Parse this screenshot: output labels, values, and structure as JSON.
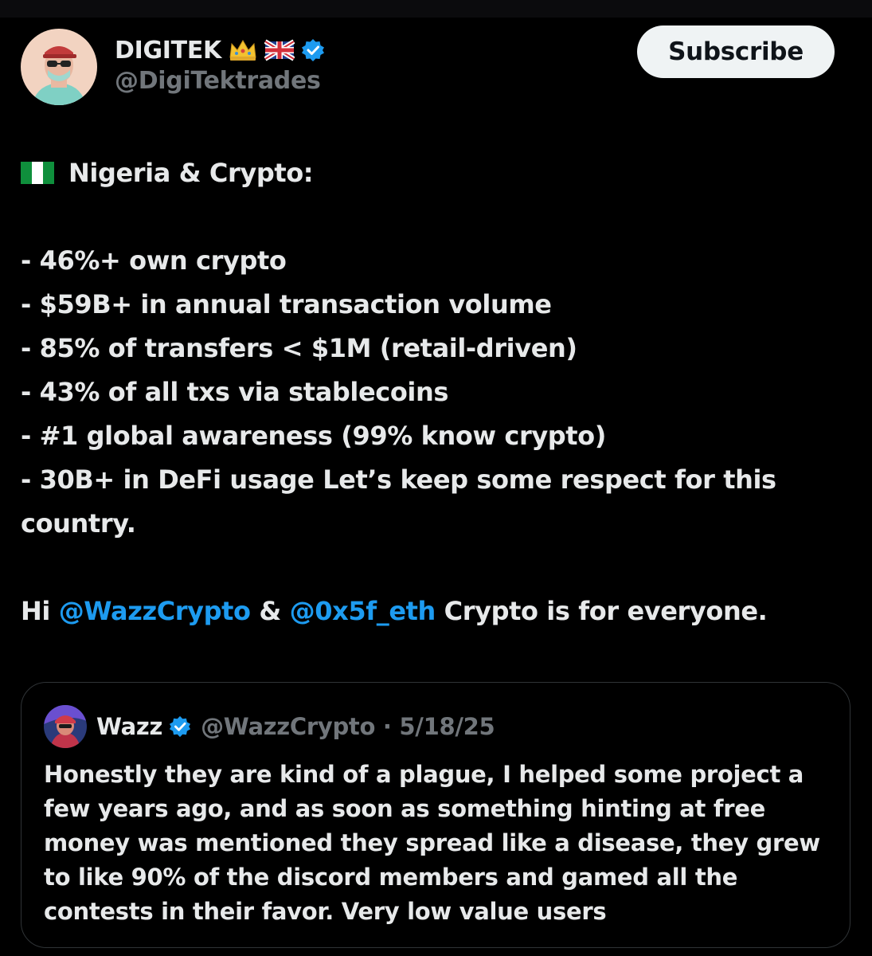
{
  "header": {
    "display_name": "DIGITEK",
    "emoji_1": "crown-emoji",
    "emoji_2": "uk-flag-emoji",
    "handle": "@DigiTektrades",
    "subscribe_label": "Subscribe"
  },
  "tweet": {
    "title": "Nigeria & Crypto:",
    "lines": [
      "- 46%+ own crypto",
      "- $59B+ in annual transaction volume",
      "- 85% of transfers < $1M (retail-driven)",
      "- 43% of all txs via stablecoins",
      "- #1 global awareness (99% know crypto)",
      "- 30B+ in DeFi usage  Let’s keep some respect for this",
      "country."
    ],
    "closing": {
      "prefix": "Hi ",
      "mention_1": "@WazzCrypto",
      "middle": " & ",
      "mention_2": "@0x5f_eth",
      "suffix": " Crypto is for everyone."
    }
  },
  "quote": {
    "name": "Wazz",
    "handle_date": "@WazzCrypto · 5/18/25",
    "lines": [
      "Honestly they are kind of a plague, I helped some project a",
      "few years ago, and as soon as something hinting at free",
      "money was mentioned they spread like a disease, they grew",
      "to like 90% of the discord members and gamed all the",
      "contests in their favor. Very low value users"
    ]
  },
  "colors": {
    "background": "#000000",
    "text": "#e7e9ea",
    "secondary": "#71767b",
    "link": "#1d9bf0",
    "verified": "#1d9bf0"
  }
}
